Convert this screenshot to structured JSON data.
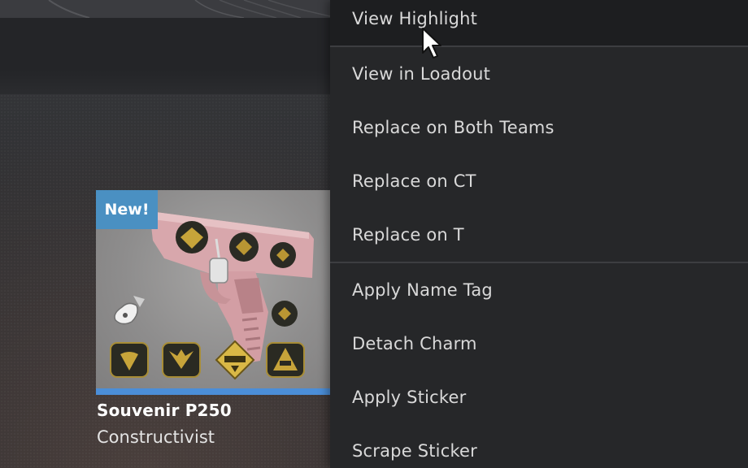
{
  "colors": {
    "menu_bg": "#262729",
    "menu_hover_bg": "#1d1e20",
    "menu_text": "#d9d9d9",
    "new_badge": "#4a90c2",
    "rarity_bar": "#4b8ed8",
    "card_bg": "#8e8d8d",
    "sticker_gold": "#c7a43a",
    "weapon_pink": "#d9a8ad"
  },
  "item": {
    "badge": "New!",
    "name": "Souvenir P250",
    "skin": "Constructivist",
    "icons": [
      "pistol-p250-image",
      "keychain-charm-icon",
      "sticker-icon"
    ]
  },
  "context_menu": {
    "items": [
      {
        "label": "View Highlight",
        "hovered": true
      },
      {
        "label": "View in Loadout"
      },
      {
        "label": "Replace on Both Teams"
      },
      {
        "label": "Replace on CT"
      },
      {
        "label": "Replace on T"
      },
      {
        "label": "Apply Name Tag"
      },
      {
        "label": "Detach Charm"
      },
      {
        "label": "Apply Sticker"
      },
      {
        "label": "Scrape Sticker"
      }
    ]
  }
}
